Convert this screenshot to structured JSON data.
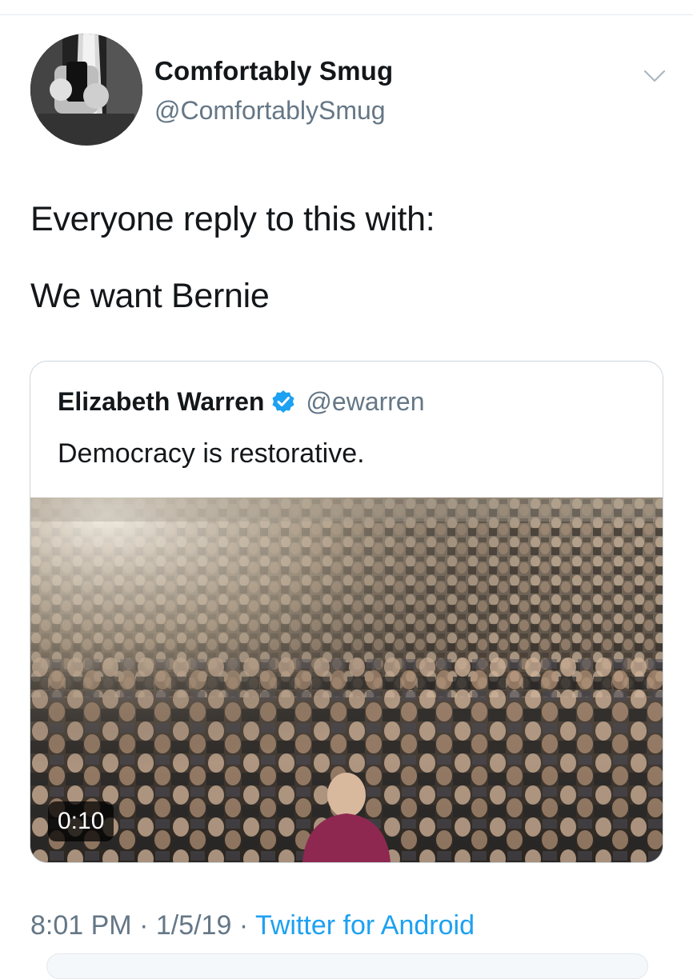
{
  "author": {
    "display_name": "Comfortably Smug",
    "handle": "@ComfortablySmug"
  },
  "tweet": {
    "line1": "Everyone reply to this with:",
    "line2": "We want Bernie"
  },
  "quoted_tweet": {
    "display_name": "Elizabeth Warren",
    "handle": "@ewarren",
    "text": "Democracy is restorative.",
    "video_duration": "0:10"
  },
  "meta": {
    "time": "8:01 PM",
    "separator": " · ",
    "date": "1/5/19",
    "source": "Twitter for Android"
  },
  "colors": {
    "link": "#1da1f2",
    "secondary_text": "#657786",
    "verified_badge": "#1da1f2"
  }
}
